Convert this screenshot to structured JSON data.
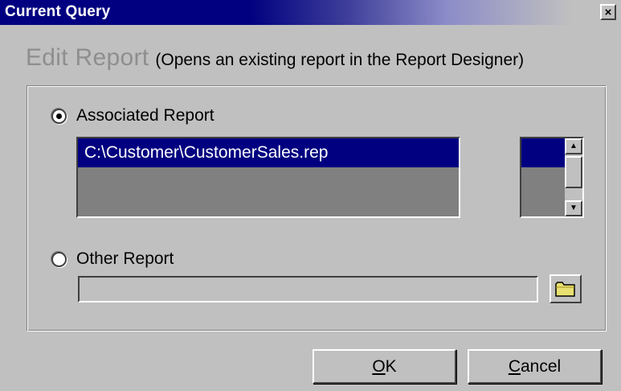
{
  "window": {
    "title": "Current Query",
    "close_glyph": "×",
    "close_icon": "close-icon"
  },
  "heading": {
    "main": "Edit Report",
    "sub": "(Opens an existing report in the Report Designer)"
  },
  "options": {
    "associated": {
      "label": "Associated Report",
      "selected": true
    },
    "other": {
      "label": "Other Report",
      "selected": false
    }
  },
  "associated_list": {
    "items": [
      "C:\\Customer\\CustomerSales.rep"
    ],
    "selected_index": 0
  },
  "other_report": {
    "path_value": "",
    "browse_icon": "folder-icon"
  },
  "scrollbar": {
    "up_glyph": "▲",
    "down_glyph": "▼"
  },
  "buttons": {
    "ok": {
      "accel": "O",
      "rest": "K"
    },
    "cancel": {
      "accel": "C",
      "rest": "ancel"
    }
  },
  "colors": {
    "title_bar": "#000080",
    "selection": "#000080",
    "dialog_face": "#c0c0c0",
    "heading_gray": "#8e8e8e",
    "folder_yellow": "#e8e070"
  }
}
